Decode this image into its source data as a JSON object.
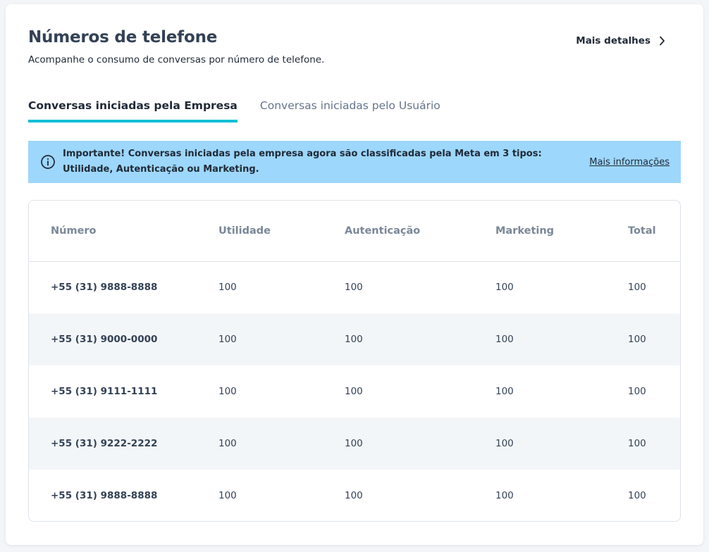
{
  "header": {
    "title": "Números de telefone",
    "subtitle": "Acompanhe o consumo de conversas por número de telefone.",
    "details_label": "Mais detalhes"
  },
  "tabs": [
    {
      "label": "Conversas iniciadas pela Empresa",
      "active": true
    },
    {
      "label": "Conversas iniciadas pelo Usuário",
      "active": false
    }
  ],
  "alert": {
    "text": "Importante! Conversas iniciadas pela empresa agora são classificadas pela Meta em 3 tipos: Utilidade, Autenticação ou Marketing.",
    "link_label": "Mais informações",
    "background": "#9dd7fb"
  },
  "table": {
    "columns": [
      "Número",
      "Utilidade",
      "Autenticação",
      "Marketing",
      "Total"
    ],
    "rows": [
      [
        "+55 (31) 9888-8888",
        "100",
        "100",
        "100",
        "100"
      ],
      [
        "+55 (31) 9000-0000",
        "100",
        "100",
        "100",
        "100"
      ],
      [
        "+55 (31) 9111-1111",
        "100",
        "100",
        "100",
        "100"
      ],
      [
        "+55 (31) 9222-2222",
        "100",
        "100",
        "100",
        "100"
      ],
      [
        "+55 (31) 9888-8888",
        "100",
        "100",
        "100",
        "100"
      ]
    ]
  },
  "colors": {
    "accent": "#12bfd6",
    "title": "#334155",
    "alert_bg": "#9dd7fb",
    "zebra_row": "#f3f6f9"
  },
  "icons": {
    "details": "chevron-right-icon",
    "alert": "info-circle-icon"
  }
}
